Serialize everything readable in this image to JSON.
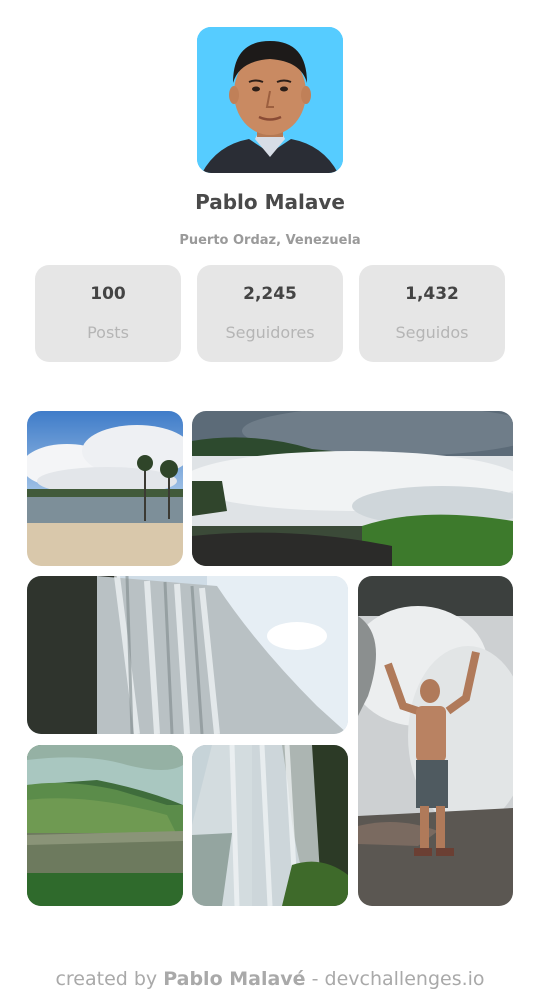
{
  "profile": {
    "name": "Pablo Malave",
    "location": "Puerto Ordaz, Venezuela",
    "avatar_bg": "#56ccff"
  },
  "stats": [
    {
      "value": "100",
      "label": "Posts"
    },
    {
      "value": "2,245",
      "label": "Seguidores"
    },
    {
      "value": "1,432",
      "label": "Seguidos"
    }
  ],
  "gallery": [
    {
      "subject": "beach-palms-photo"
    },
    {
      "subject": "waterfall-river-photo"
    },
    {
      "subject": "waterfall-curtain-photo"
    },
    {
      "subject": "man-at-waterfall-photo"
    },
    {
      "subject": "tepui-aerial-photo"
    },
    {
      "subject": "waterfall-cliff-photo"
    }
  ],
  "footer": {
    "prefix": "created by",
    "author": "Pablo Malavé",
    "separator": "-",
    "site": "devchallenges.io"
  }
}
